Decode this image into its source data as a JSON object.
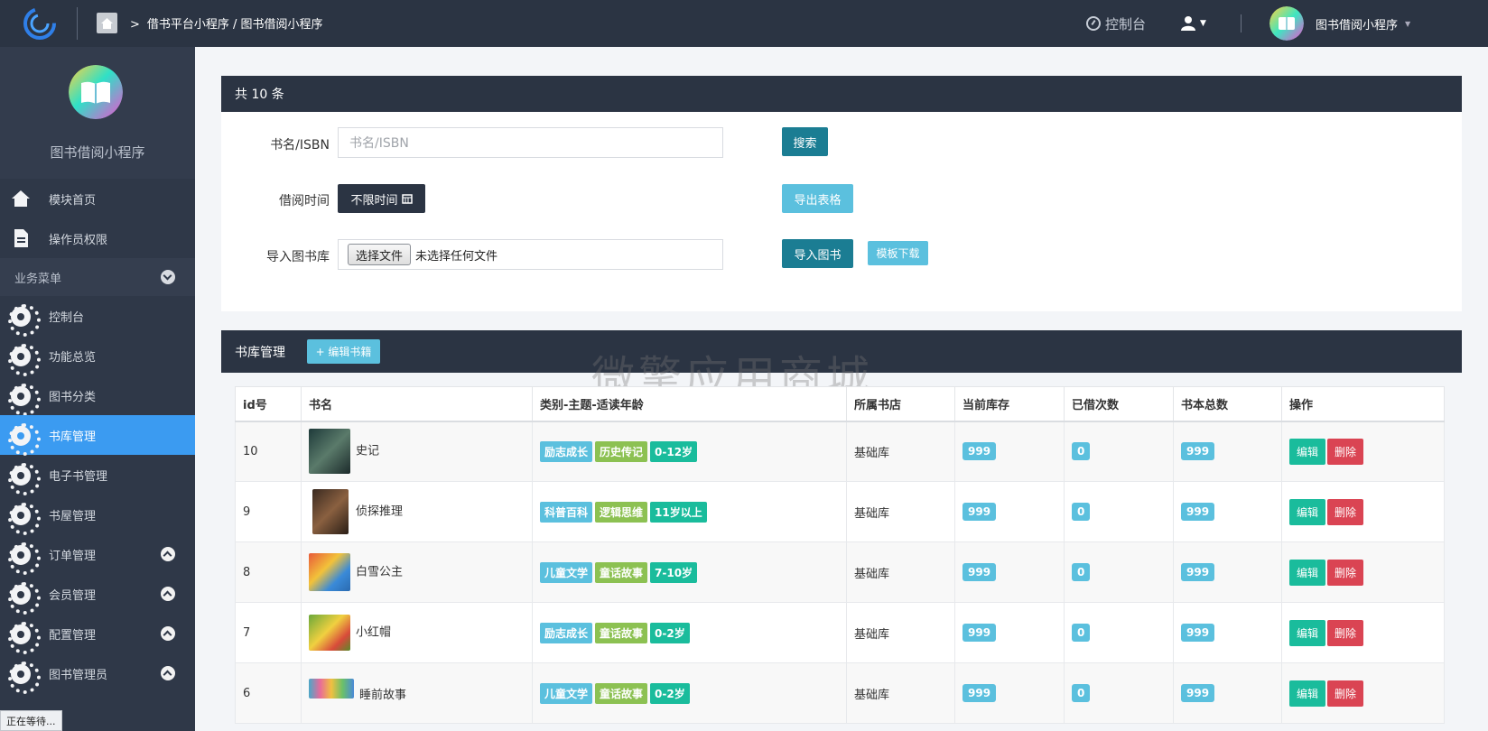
{
  "topbar": {
    "breadcrumb": "借书平台小程序 / 图书借阅小程序",
    "dashboard": "控制台",
    "site_name": "图书借阅小程序"
  },
  "sidebar": {
    "app_name": "图书借阅小程序",
    "top_items": [
      {
        "label": "模块首页",
        "icon": "home-icon"
      },
      {
        "label": "操作员权限",
        "icon": "document-icon"
      }
    ],
    "group_label": "业务菜单",
    "items": [
      {
        "label": "控制台"
      },
      {
        "label": "功能总览"
      },
      {
        "label": "图书分类"
      },
      {
        "label": "书库管理"
      },
      {
        "label": "电子书管理"
      },
      {
        "label": "书屋管理"
      },
      {
        "label": "订单管理"
      },
      {
        "label": "会员管理"
      },
      {
        "label": "配置管理"
      },
      {
        "label": "图书管理员"
      }
    ]
  },
  "status_text": "正在等待...",
  "filter_panel": {
    "header": "共 10 条",
    "search_label": "书名/ISBN",
    "search_placeholder": "书名/ISBN",
    "search_button": "搜索",
    "time_label": "借阅时间",
    "time_button": "不限时间",
    "export_button": "导出表格",
    "import_label": "导入图书库",
    "file_button": "选择文件",
    "file_status": "未选择任何文件",
    "import_button": "导入图书",
    "template_button": "模板下载"
  },
  "table_panel": {
    "title": "书库管理",
    "edit_books_button": "+ 编辑书籍",
    "watermark": "微擎应用商城",
    "columns": [
      "id号",
      "书名",
      "类别-主题-适读年龄",
      "所属书店",
      "当前库存",
      "已借次数",
      "书本总数",
      "操作"
    ],
    "edit_label": "编辑",
    "delete_label": "删除",
    "rows": [
      {
        "id": "10",
        "name": "史记",
        "tags": [
          "励志成长",
          "历史传记",
          "0-12岁"
        ],
        "store": "基础库",
        "stock": "999",
        "borrowed": "0",
        "total": "999"
      },
      {
        "id": "9",
        "name": "侦探推理",
        "tags": [
          "科普百科",
          "逻辑思维",
          "11岁以上"
        ],
        "store": "基础库",
        "stock": "999",
        "borrowed": "0",
        "total": "999"
      },
      {
        "id": "8",
        "name": "白雪公主",
        "tags": [
          "儿童文学",
          "童话故事",
          "7-10岁"
        ],
        "store": "基础库",
        "stock": "999",
        "borrowed": "0",
        "total": "999"
      },
      {
        "id": "7",
        "name": "小红帽",
        "tags": [
          "励志成长",
          "童话故事",
          "0-2岁"
        ],
        "store": "基础库",
        "stock": "999",
        "borrowed": "0",
        "total": "999"
      },
      {
        "id": "6",
        "name": "睡前故事",
        "tags": [
          "儿童文学",
          "童话故事",
          "0-2岁"
        ],
        "store": "基础库",
        "stock": "999",
        "borrowed": "0",
        "total": "999"
      }
    ]
  }
}
